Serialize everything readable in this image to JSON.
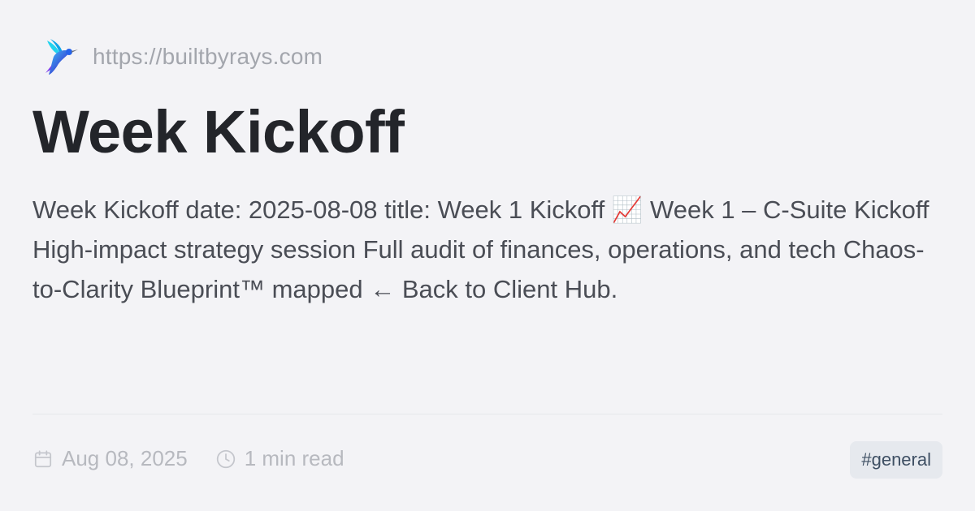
{
  "site": {
    "url": "https://builtbyrays.com",
    "logo_icon": "hummingbird-logo-icon"
  },
  "post": {
    "title": "Week Kickoff",
    "description": "Week Kickoff date: 2025-08-08 title: Week 1 Kickoff 📈 Week 1 – C-Suite Kickoff High-impact strategy session Full audit of finances, operations, and tech Chaos-to-Clarity Blueprint™ mapped ← Back to Client Hub.",
    "date": "Aug 08, 2025",
    "read_time": "1 min read",
    "tag": "#general"
  },
  "icons": {
    "date": "calendar-icon",
    "read_time": "clock-icon"
  },
  "colors": {
    "background": "#f3f3f6",
    "title": "#23252a",
    "body_text": "#4a4d55",
    "muted": "#b7b9bf",
    "tag_bg": "#e6e9ee",
    "tag_text": "#3e4f63"
  }
}
